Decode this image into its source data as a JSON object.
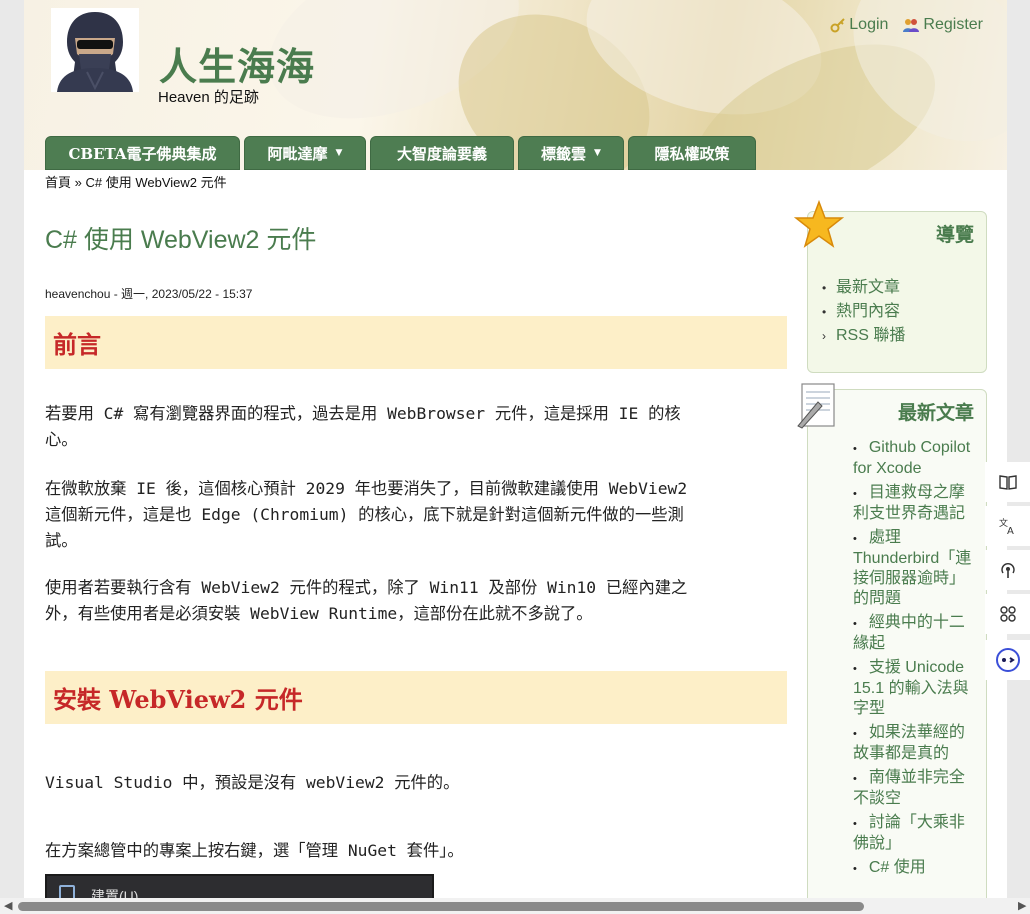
{
  "site": {
    "name": "人生海海",
    "slogan": "Heaven 的足跡"
  },
  "user_links": {
    "login": "Login",
    "register": "Register"
  },
  "nav": [
    {
      "label": "CBETA電子佛典集成",
      "dropdown": false
    },
    {
      "label": "阿毗達摩",
      "dropdown": true
    },
    {
      "label": "大智度論要義",
      "dropdown": false
    },
    {
      "label": "標籤雲",
      "dropdown": true
    },
    {
      "label": "隱私權政策",
      "dropdown": false
    }
  ],
  "breadcrumb": {
    "home": "首頁",
    "separator": "»",
    "current": "C# 使用 WebView2 元件"
  },
  "article": {
    "title": "C# 使用 WebView2 元件",
    "meta": "heavenchou - 週一, 2023/05/22 - 15:37",
    "heading1": "前言",
    "para1_line1": "若要用 C# 寫有瀏覽器界面的程式，過去是用 WebBrowser 元件，這是採用 IE 的核",
    "para1_line2": "心。",
    "para2_line1": "在微軟放棄 IE 後，這個核心預計 2029 年也要消失了，目前微軟建議使用 WebView2",
    "para2_line2": "這個新元件，這是也 Edge (Chromium) 的核心，底下就是針對這個新元件做的一些測",
    "para2_line3": "試。",
    "para3_line1": "使用者若要執行含有 WebView2 元件的程式，除了 Win11 及部份 Win10 已經內建之",
    "para3_line2": "外，有些使用者是必須安裝 WebView Runtime，這部份在此就不多說了。",
    "heading2": "安裝 WebView2 元件",
    "para4": "Visual Studio 中，預設是沒有 webView2 元件的。",
    "para5": "在方案總管中的專案上按右鍵，選「管理 NuGet 套件」。",
    "screenshot_menu_item": "建置(U)"
  },
  "sidebar": {
    "navigation": {
      "title": "導覽",
      "items": [
        {
          "label": "最新文章",
          "marker": "•"
        },
        {
          "label": "熱門內容",
          "marker": "•"
        },
        {
          "label": "RSS 聯播",
          "marker": "›"
        }
      ]
    },
    "recent": {
      "title": "最新文章",
      "items": [
        "Github Copilot for Xcode",
        "目連救母之摩利支世界奇遇記",
        "處理 Thunderbird「連接伺服器逾時」的問題",
        "經典中的十二緣起",
        "支援 Unicode 15.1 的輸入法與字型",
        "如果法華經的故事都是真的",
        "南傳並非完全不談空",
        "討論「大乘非佛說」",
        "C# 使用"
      ]
    }
  },
  "right_tools": [
    "book-icon",
    "translate-icon",
    "podcast-icon",
    "apps-icon",
    "copilot-icon"
  ],
  "colors": {
    "brand_green": "#4a7c4e",
    "nav_green": "#4e7d52",
    "heading_red": "#c62828",
    "heading_bg": "#fdefc8"
  }
}
